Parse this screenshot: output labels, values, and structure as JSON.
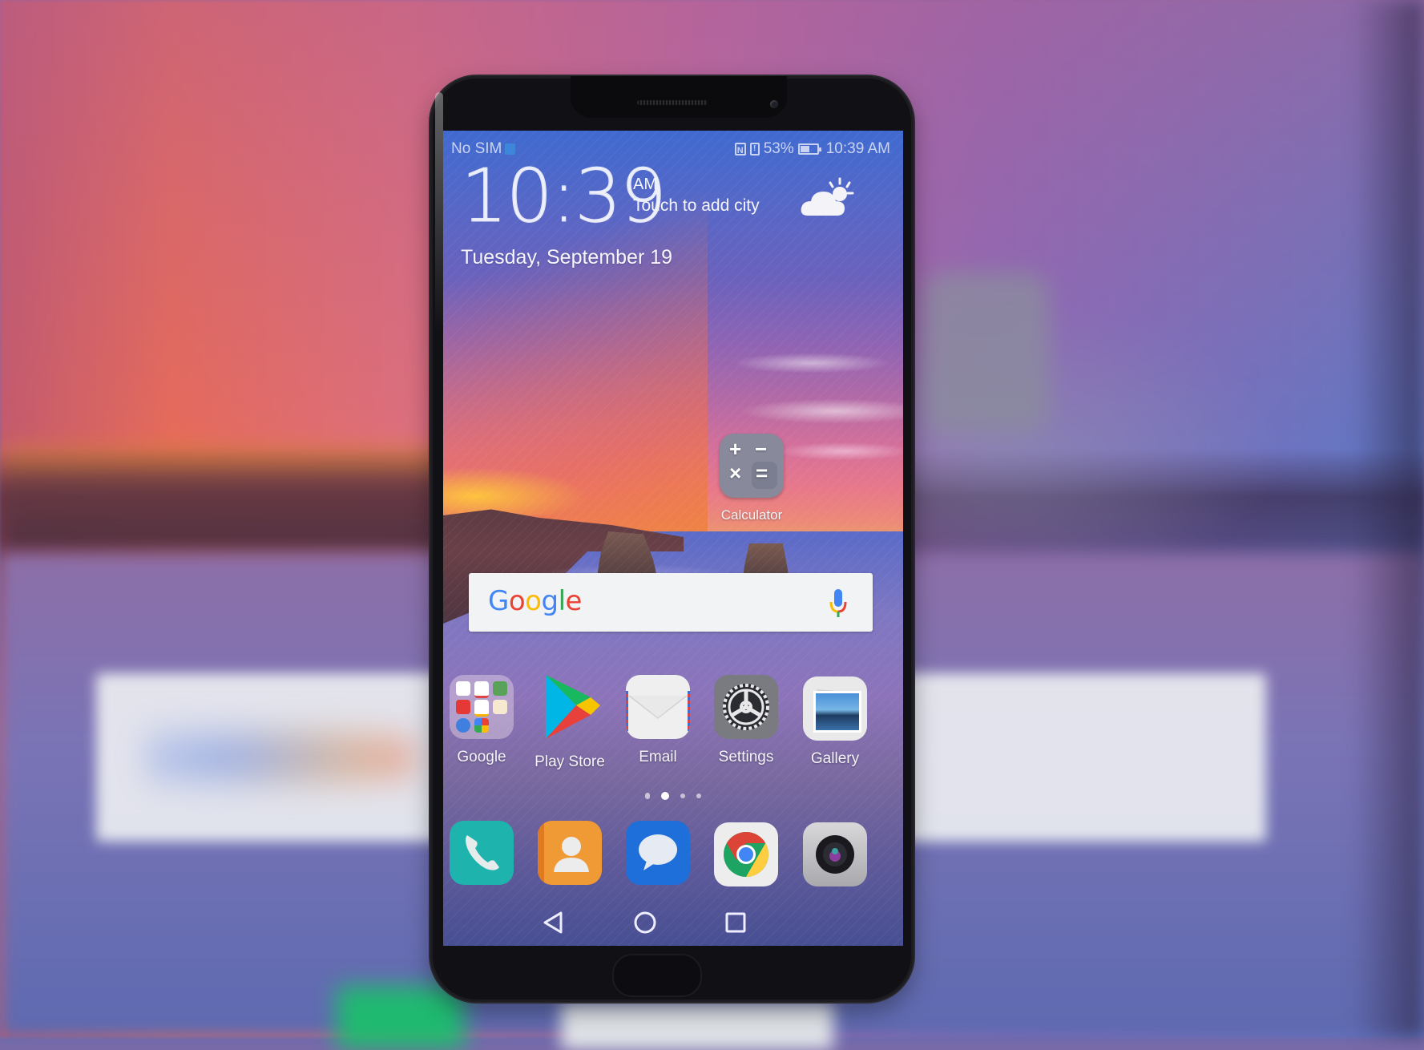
{
  "status_bar": {
    "carrier": "No SIM",
    "nfc_icon": "nfc-icon",
    "sd_icon": "sd-card-icon",
    "battery_percent": "53%",
    "battery_level": 0.53,
    "time": "10:39 AM"
  },
  "clock_widget": {
    "time": "10:39",
    "ampm": "AM",
    "city_prompt": "Touch to add city",
    "date": "Tuesday, September 19",
    "weather_icon": "partly-cloudy-icon"
  },
  "calculator": {
    "label": "Calculator",
    "symbols": [
      "+",
      "−",
      "×",
      "="
    ]
  },
  "search_widget": {
    "logo_letters": [
      {
        "ch": "G",
        "color": "#4285F4"
      },
      {
        "ch": "o",
        "color": "#EA4335"
      },
      {
        "ch": "o",
        "color": "#FBBC05"
      },
      {
        "ch": "g",
        "color": "#4285F4"
      },
      {
        "ch": "l",
        "color": "#34A853"
      },
      {
        "ch": "e",
        "color": "#EA4335"
      }
    ],
    "mic_icon": "microphone-icon"
  },
  "apps_row": [
    {
      "label": "Google",
      "icon": "google-folder-icon"
    },
    {
      "label": "Play Store",
      "icon": "play-store-icon"
    },
    {
      "label": "Email",
      "icon": "email-icon"
    },
    {
      "label": "Settings",
      "icon": "settings-gear-icon"
    },
    {
      "label": "Gallery",
      "icon": "gallery-icon"
    }
  ],
  "page_indicator": {
    "pages": 4,
    "current": 2
  },
  "dock": [
    {
      "name": "Phone",
      "icon": "phone-icon",
      "color": "#1fb3ad"
    },
    {
      "name": "Contacts",
      "icon": "contacts-icon",
      "color": "#f09a36"
    },
    {
      "name": "Messaging",
      "icon": "messages-icon",
      "color": "#1e6fd9"
    },
    {
      "name": "Chrome",
      "icon": "chrome-icon",
      "color": "#ededed"
    },
    {
      "name": "Camera",
      "icon": "camera-icon",
      "color": "#c9c9cc"
    }
  ],
  "nav_bar": {
    "back": "back-icon",
    "home": "home-icon",
    "recents": "recents-icon"
  }
}
